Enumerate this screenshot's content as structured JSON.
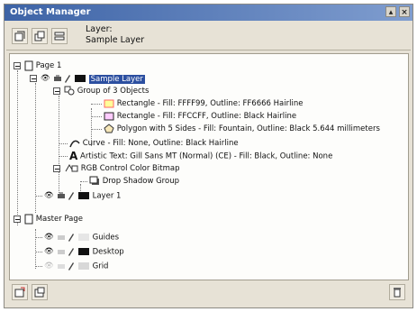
{
  "window": {
    "title": "Object Manager"
  },
  "toolbar": {
    "layer_caption": "Layer:",
    "layer_name": "Sample Layer"
  },
  "tree": {
    "page1": "Page 1",
    "sample_layer": "Sample Layer",
    "group": "Group of 3 Objects",
    "rect1": "Rectangle - Fill: FFFF99, Outline: FF6666  Hairline",
    "rect2": "Rectangle - Fill: FFCCFF, Outline: Black  Hairline",
    "polygon": "Polygon with 5 Sides - Fill: Fountain, Outline: Black  5.644 millimeters",
    "curve": "Curve - Fill: None, Outline: Black  Hairline",
    "text": "Artistic Text: Gill Sans MT (Normal) (CE) - Fill: Black, Outline: None",
    "bitmap": "RGB Control Color Bitmap",
    "dropshadow": "Drop Shadow Group",
    "layer1": "Layer 1",
    "master": "Master Page",
    "guides": "Guides",
    "desktop": "Desktop",
    "grid": "Grid"
  },
  "colors": {
    "rect1_fill": "#FFFF99",
    "rect1_outline": "#FF6666",
    "rect2_fill": "#FFCCFF",
    "selection": "#2c4fa0"
  }
}
